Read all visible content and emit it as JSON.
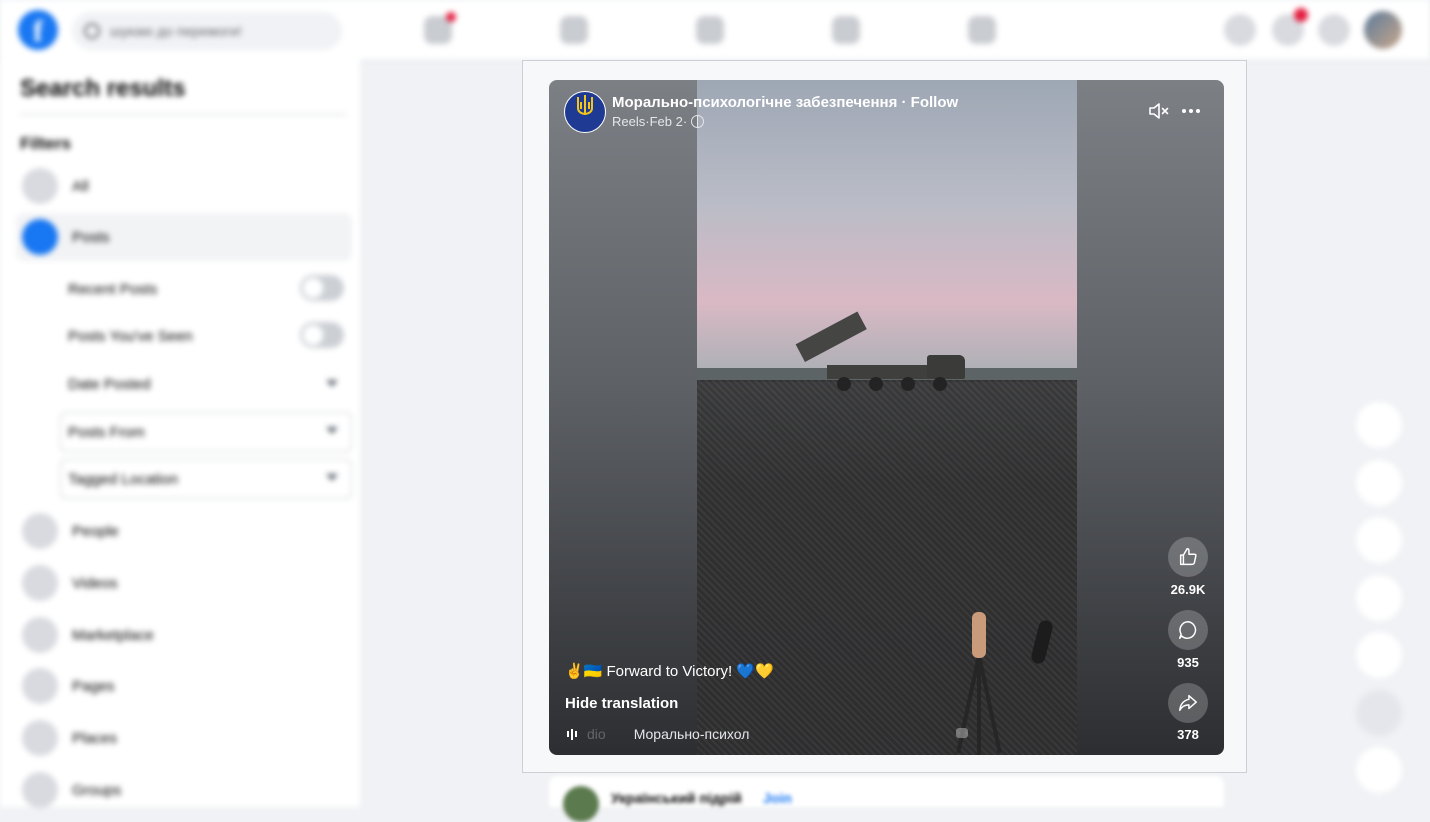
{
  "topbar": {
    "search_placeholder": "шукаю до перемоги!"
  },
  "sidebar": {
    "title": "Search results",
    "filters_label": "Filters",
    "items": [
      {
        "label": "All"
      },
      {
        "label": "Posts"
      },
      {
        "label": "People"
      },
      {
        "label": "Videos"
      },
      {
        "label": "Marketplace"
      },
      {
        "label": "Pages"
      },
      {
        "label": "Places"
      },
      {
        "label": "Groups"
      }
    ],
    "post_filters": {
      "recent_posts": "Recent Posts",
      "posts_seen": "Posts You've Seen",
      "date_posted": "Date Posted",
      "posts_from": "Posts From",
      "tagged_location": "Tagged Location"
    }
  },
  "reel": {
    "page_name": "Морально-психологічне забезпечення",
    "separator": " · ",
    "follow_label": "Follow",
    "meta_source": "Reels",
    "meta_date": "Feb 2",
    "likes": "26.9K",
    "comments": "935",
    "shares": "378",
    "caption": "✌️🇺🇦 Forward to Victory! 💙💛",
    "hide_translation": "Hide translation",
    "audio_faded": "dio",
    "audio_label": "Морально-психол"
  },
  "next_post": {
    "author": "Український підрій",
    "join_label": "Join"
  }
}
